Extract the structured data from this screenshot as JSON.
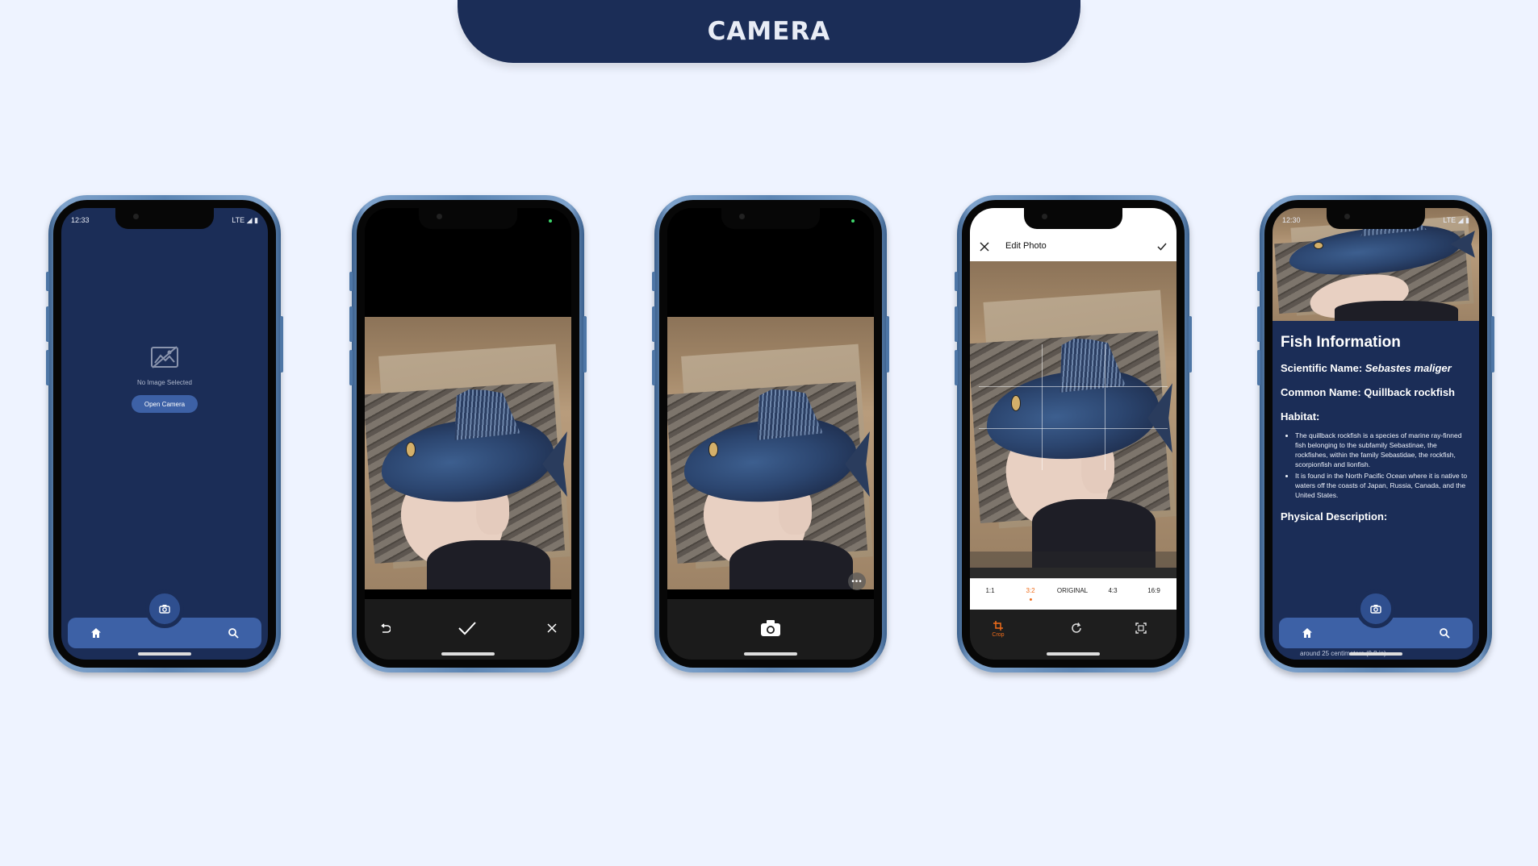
{
  "banner": {
    "title": "CAMERA"
  },
  "phone1": {
    "status_time": "12:33",
    "status_right": "LTE",
    "empty_text": "No Image Selected",
    "open_camera_label": "Open Camera"
  },
  "phone4": {
    "title": "Edit Photo",
    "ratios": [
      "1:1",
      "3:2",
      "ORIGINAL",
      "4:3",
      "16:9"
    ],
    "selected_ratio": "3:2",
    "crop_label": "Crop",
    "accent": "#ef6c1a"
  },
  "phone5": {
    "status_time": "12:30",
    "status_right": "LTE",
    "heading": "Fish Information",
    "scientific_label": "Scientific Name: ",
    "scientific_value": "Sebastes maliger",
    "common_name": "Common Name: Quillback rockfish",
    "habitat_label": "Habitat:",
    "habitat_items": [
      "The quillback rockfish is a species of marine ray-finned fish belonging to the subfamily Sebastinae, the rockfishes, within the family Sebastidae, the rockfish, scorpionfish and lionfish.",
      "It is found in the North Pacific Ocean where it is native to waters off the coasts of Japan, Russia, Canada, and the United States."
    ],
    "physical_label": "Physical Description:",
    "overflow_text": "around 25 centimeters (9.8 in)"
  },
  "colors": {
    "navy": "#1b2d57",
    "nav_blue": "#3d61a6",
    "background": "#eef3ff"
  }
}
